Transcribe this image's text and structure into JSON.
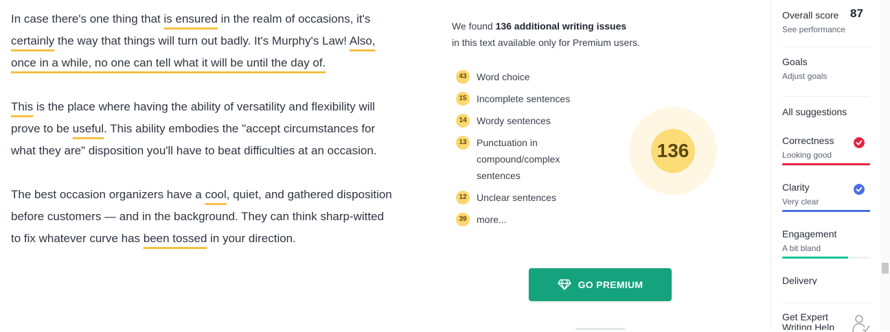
{
  "editor": {
    "p1": {
      "t1": "In case there's one thing that ",
      "u1": "is ensured",
      "t2": " in the realm of occasions, it's ",
      "u2": "certainly",
      "t3": " the way that things will turn out badly. It's Murphy's Law! ",
      "u3": "Also, once in a while, no one can tell what it will be until the day of.",
      "t4": ""
    },
    "p2": {
      "u1": "This",
      "t1": " is the place where having the ability of versatility and flexibility will prove to be ",
      "u2": "useful",
      "t2": ". This ability embodies the \"accept circumstances for what they are\" disposition you'll have to beat difficulties at an occasion."
    },
    "p3": {
      "t1": "The best occasion organizers have a ",
      "u1": "cool",
      "t2": ", quiet, and gathered disposition before customers — and in the background. They can think sharp-witted to fix whatever curve has ",
      "u2": "been tossed",
      "t3": " in your direction."
    }
  },
  "premium_panel": {
    "found_prefix": "We found ",
    "found_count": "136 additional writing issues",
    "found_suffix": "in this text available only for Premium users.",
    "issues": [
      {
        "count": "43",
        "label": "Word choice"
      },
      {
        "count": "15",
        "label": "Incomplete sentences"
      },
      {
        "count": "14",
        "label": "Wordy sentences"
      },
      {
        "count": "13",
        "label": "Punctuation in compound/complex sentences"
      },
      {
        "count": "12",
        "label": "Unclear sentences"
      },
      {
        "count": "39",
        "label": "more..."
      }
    ],
    "total": "136",
    "button_label": "GO PREMIUM",
    "button_icon": "diamond-icon"
  },
  "sidebar": {
    "overall_label": "Overall score",
    "overall_score": "87",
    "overall_sub": "See performance",
    "goals_label": "Goals",
    "goals_sub": "Adjust goals",
    "all_suggestions": "All suggestions",
    "categories": [
      {
        "label": "Correctness",
        "status": "Looking good",
        "color": "#e5223f",
        "icon": "check-circle-icon"
      },
      {
        "label": "Clarity",
        "status": "Very clear",
        "color": "#4a6ee0",
        "icon": "check-circle-icon"
      },
      {
        "label": "Engagement",
        "status": "A bit bland",
        "color": "#15c39a",
        "level": 0.75
      },
      {
        "label": "Delivery",
        "status": "",
        "color": "#8a8f9c"
      }
    ],
    "expert_label": "Get Expert Writing Help",
    "expert_icon": "person-icon"
  }
}
